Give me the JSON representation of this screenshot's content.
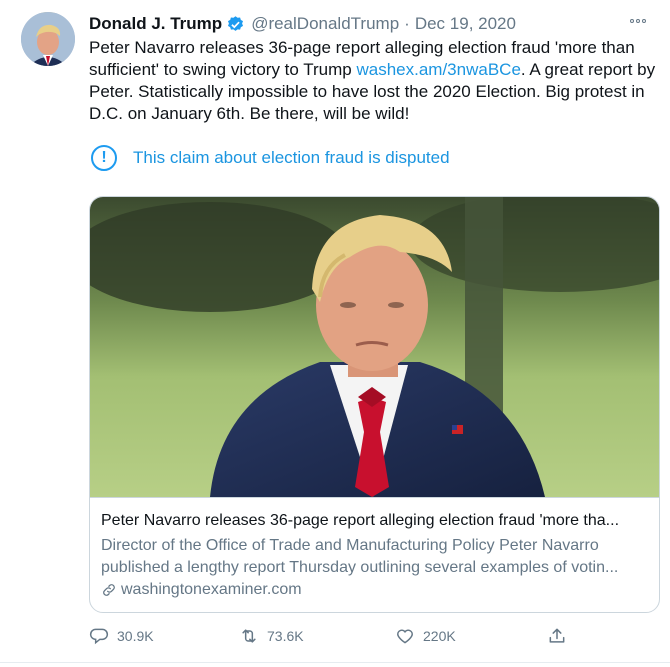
{
  "tweet": {
    "author_name": "Donald J. Trump",
    "handle": "@realDonaldTrump",
    "separator": "·",
    "date": "Dec 19, 2020",
    "text_before_link": "Peter Navarro releases 36-page report alleging election fraud 'more than sufficient' to swing victory to Trump ",
    "link_text": "washex.am/3nwaBCe",
    "text_after_link": ". A great report by Peter. Statistically impossible to have lost the 2020 Election. Big protest in D.C. on January 6th. Be there, will be wild!",
    "notice_icon": "!",
    "notice_text": "This claim about election fraud is disputed"
  },
  "card": {
    "title": "Peter Navarro releases 36-page report alleging election fraud 'more tha...",
    "description_line1": "Director of the Office of Trade and Manufacturing Policy Peter Navarro",
    "description_line2": "published a lengthy report Thursday outlining several examples of votin...",
    "domain": "washingtonexaminer.com"
  },
  "actions": {
    "replies": "30.9K",
    "retweets": "73.6K",
    "likes": "220K"
  },
  "icons": {
    "verified": "verified-badge-icon",
    "more": "more-options-icon",
    "notice": "info-exclamation-icon",
    "link": "link-icon",
    "reply": "reply-icon",
    "retweet": "retweet-icon",
    "like": "heart-icon",
    "share": "share-icon"
  },
  "colors": {
    "accent": "#1d9bf0",
    "text": "#0f1419",
    "secondary": "#657786",
    "border": "#ccd6dd"
  }
}
